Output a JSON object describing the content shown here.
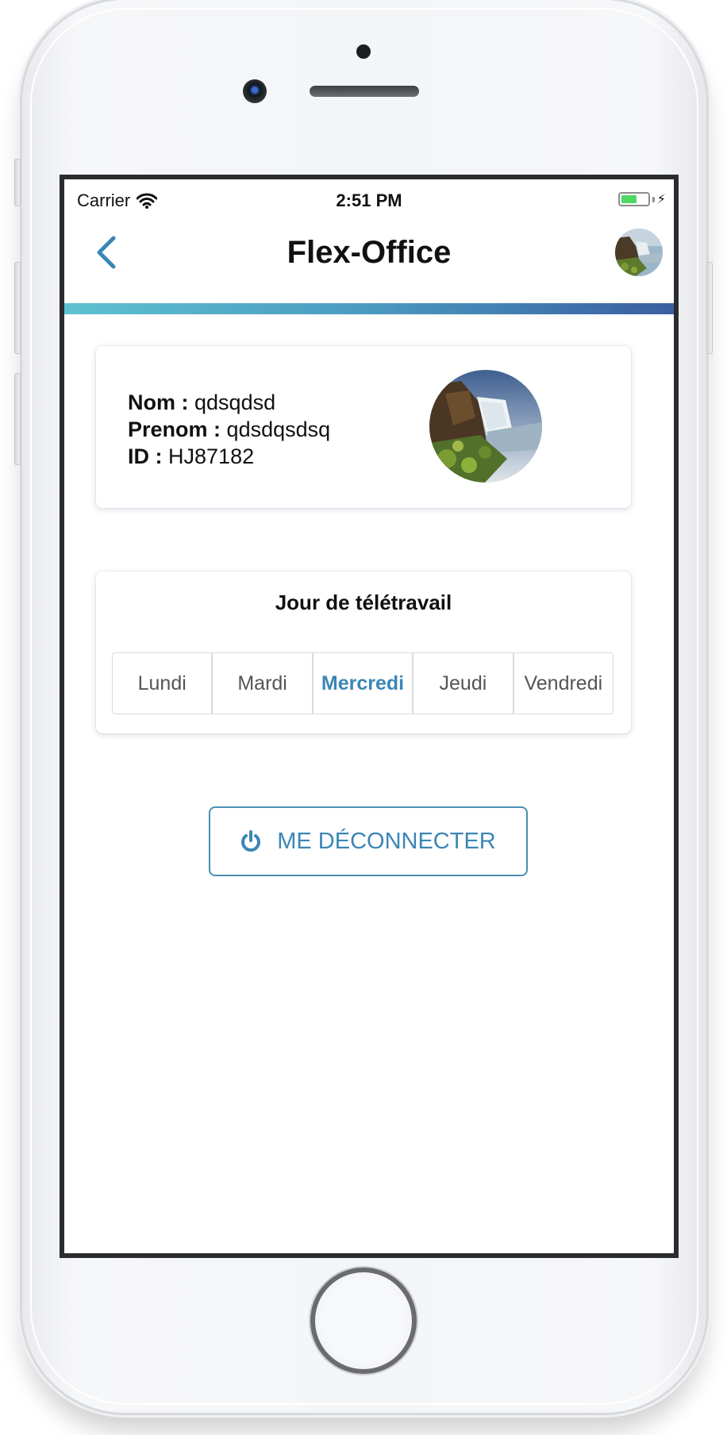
{
  "status_bar": {
    "carrier": "Carrier",
    "time": "2:51 PM",
    "battery_color": "#4cd964"
  },
  "nav": {
    "back_icon": "chevron-left-icon",
    "title": "Flex-Office",
    "avatar": "waterfall-photo"
  },
  "profile": {
    "nom_label": "Nom :",
    "nom_value": "qdsqdsd",
    "prenom_label": "Prenom :",
    "prenom_value": "qdsdqsdsq",
    "id_label": "ID :",
    "id_value": "HJ87182",
    "photo": "waterfall-photo"
  },
  "remote_days": {
    "title": "Jour de télétravail",
    "days": [
      "Lundi",
      "Mardi",
      "Mercredi",
      "Jeudi",
      "Vendredi"
    ],
    "selected": "Mercredi"
  },
  "logout": {
    "icon": "power-icon",
    "label": "ME DÉCONNECTER"
  },
  "colors": {
    "accent": "#3b86b6",
    "gradient_start": "#5fc1d1",
    "gradient_end": "#3a5fa0"
  }
}
